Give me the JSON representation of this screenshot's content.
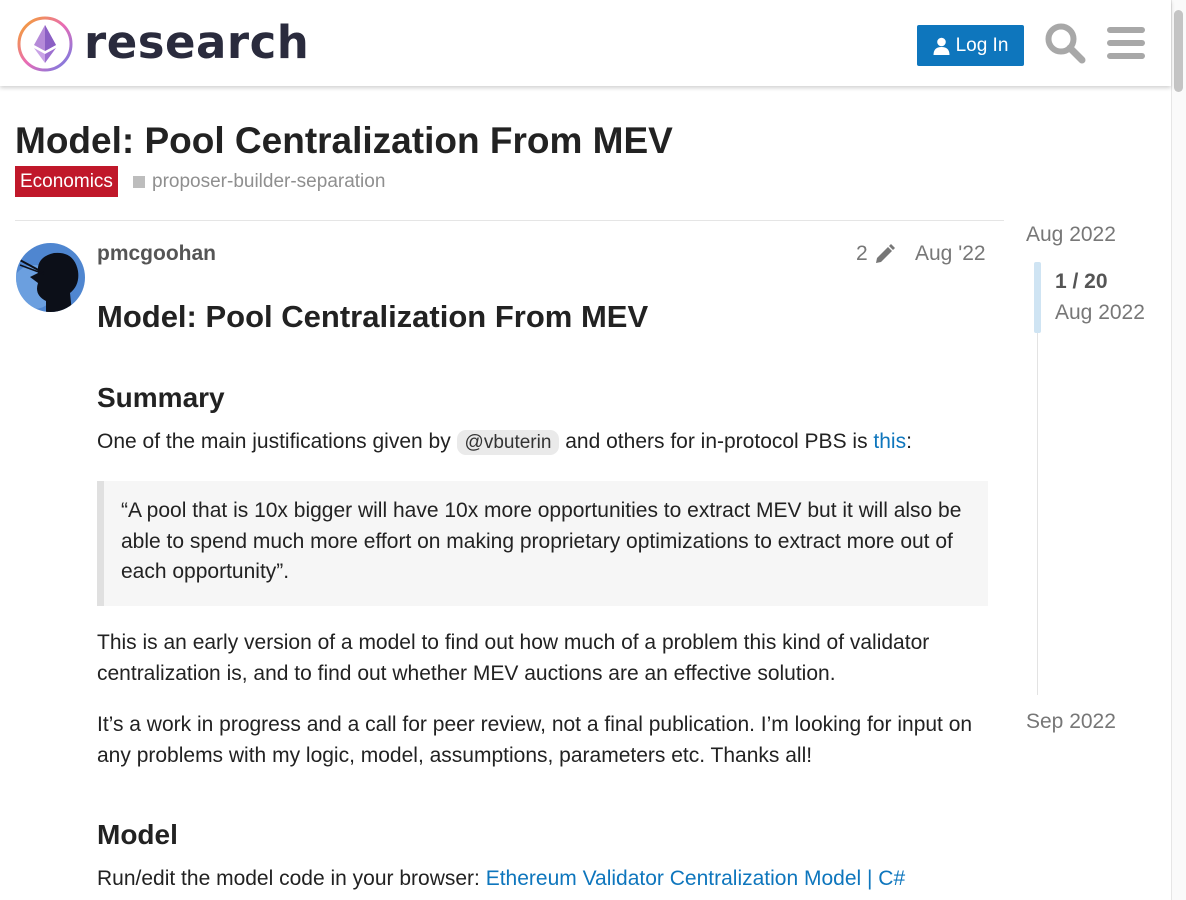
{
  "header": {
    "logo_text": "research",
    "login_label": "Log In",
    "search_icon": "search-icon",
    "menu_icon": "hamburger-menu-icon"
  },
  "topic": {
    "title": "Model: Pool Centralization From MEV",
    "category": "Economics",
    "tag": "proposer-builder-separation",
    "colors": {
      "category": "#c0182a",
      "accent": "#0e76bd"
    }
  },
  "post": {
    "author": "pmcgoohan",
    "edit_count": "2",
    "date": "Aug '22",
    "h1": "Model: Pool Centralization From MEV",
    "summary_heading": "Summary",
    "p1_before": "One of the main justifications given by ",
    "p1_mention": "@vbuterin",
    "p1_middle": " and others for in-protocol PBS is ",
    "p1_link": "this",
    "p1_after": ":",
    "quote": "“A pool that is 10x bigger will have 10x more opportunities to extract MEV but it will also be able to spend much more effort on making proprietary optimizations to extract more out of each opportunity”.",
    "p2": "This is an early version of a model to find out how much of a problem this kind of validator centralization is, and to find out whether MEV auctions are an effective solution.",
    "p3": "It’s a work in progress and a call for peer review, not a final publication. I’m looking for input on any problems with my logic, model, assumptions, parameters etc. Thanks all!",
    "model_heading": "Model",
    "p4_before": "Run/edit the model code in your browser: ",
    "p4_link": "Ethereum Validator Centralization Model | C#"
  },
  "timeline": {
    "start": "Aug 2022",
    "position": "1 / 20",
    "position_date": "Aug 2022",
    "end": "Sep 2022"
  }
}
